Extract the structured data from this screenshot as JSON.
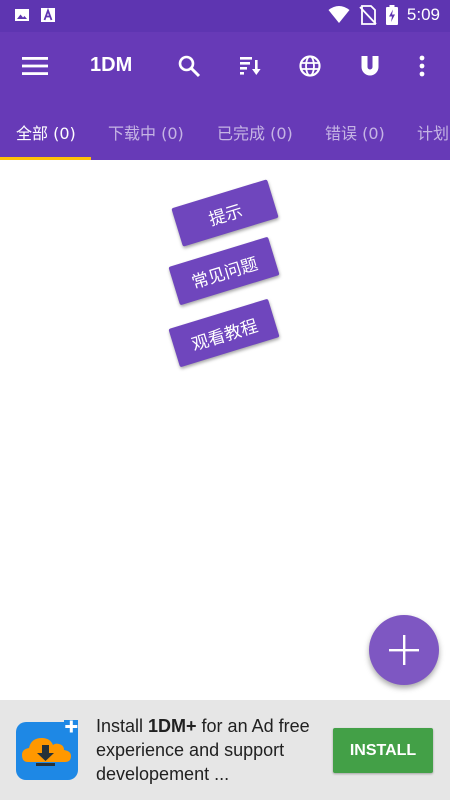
{
  "status_bar": {
    "time": "5:09",
    "icons": [
      "image-icon",
      "a-icon",
      "wifi-icon",
      "no-sim-icon",
      "battery-charging-icon"
    ]
  },
  "app_bar": {
    "title": "1DM",
    "actions": [
      "search-icon",
      "sort-icon",
      "globe-icon",
      "magnet-icon",
      "more-vertical-icon"
    ]
  },
  "tabs": [
    {
      "label": "全部 (0)",
      "active": true
    },
    {
      "label": "下载中 (0)",
      "active": false
    },
    {
      "label": "已完成 (0)",
      "active": false
    },
    {
      "label": "错误 (0)",
      "active": false
    },
    {
      "label": "计划",
      "active": false
    }
  ],
  "hint_buttons": {
    "tips": "提示",
    "faq": "常见问题",
    "tutorial": "观看教程"
  },
  "ad": {
    "prefix": "Install ",
    "brand": "1DM+",
    "suffix": " for an Ad free experience and support developement ...",
    "install_label": "INSTALL"
  },
  "colors": {
    "status_bar": "#5e35b1",
    "app_bar": "#673ab7",
    "tab_indicator": "#ffc107",
    "fab": "#7e57c2",
    "install_button": "#43a047"
  }
}
